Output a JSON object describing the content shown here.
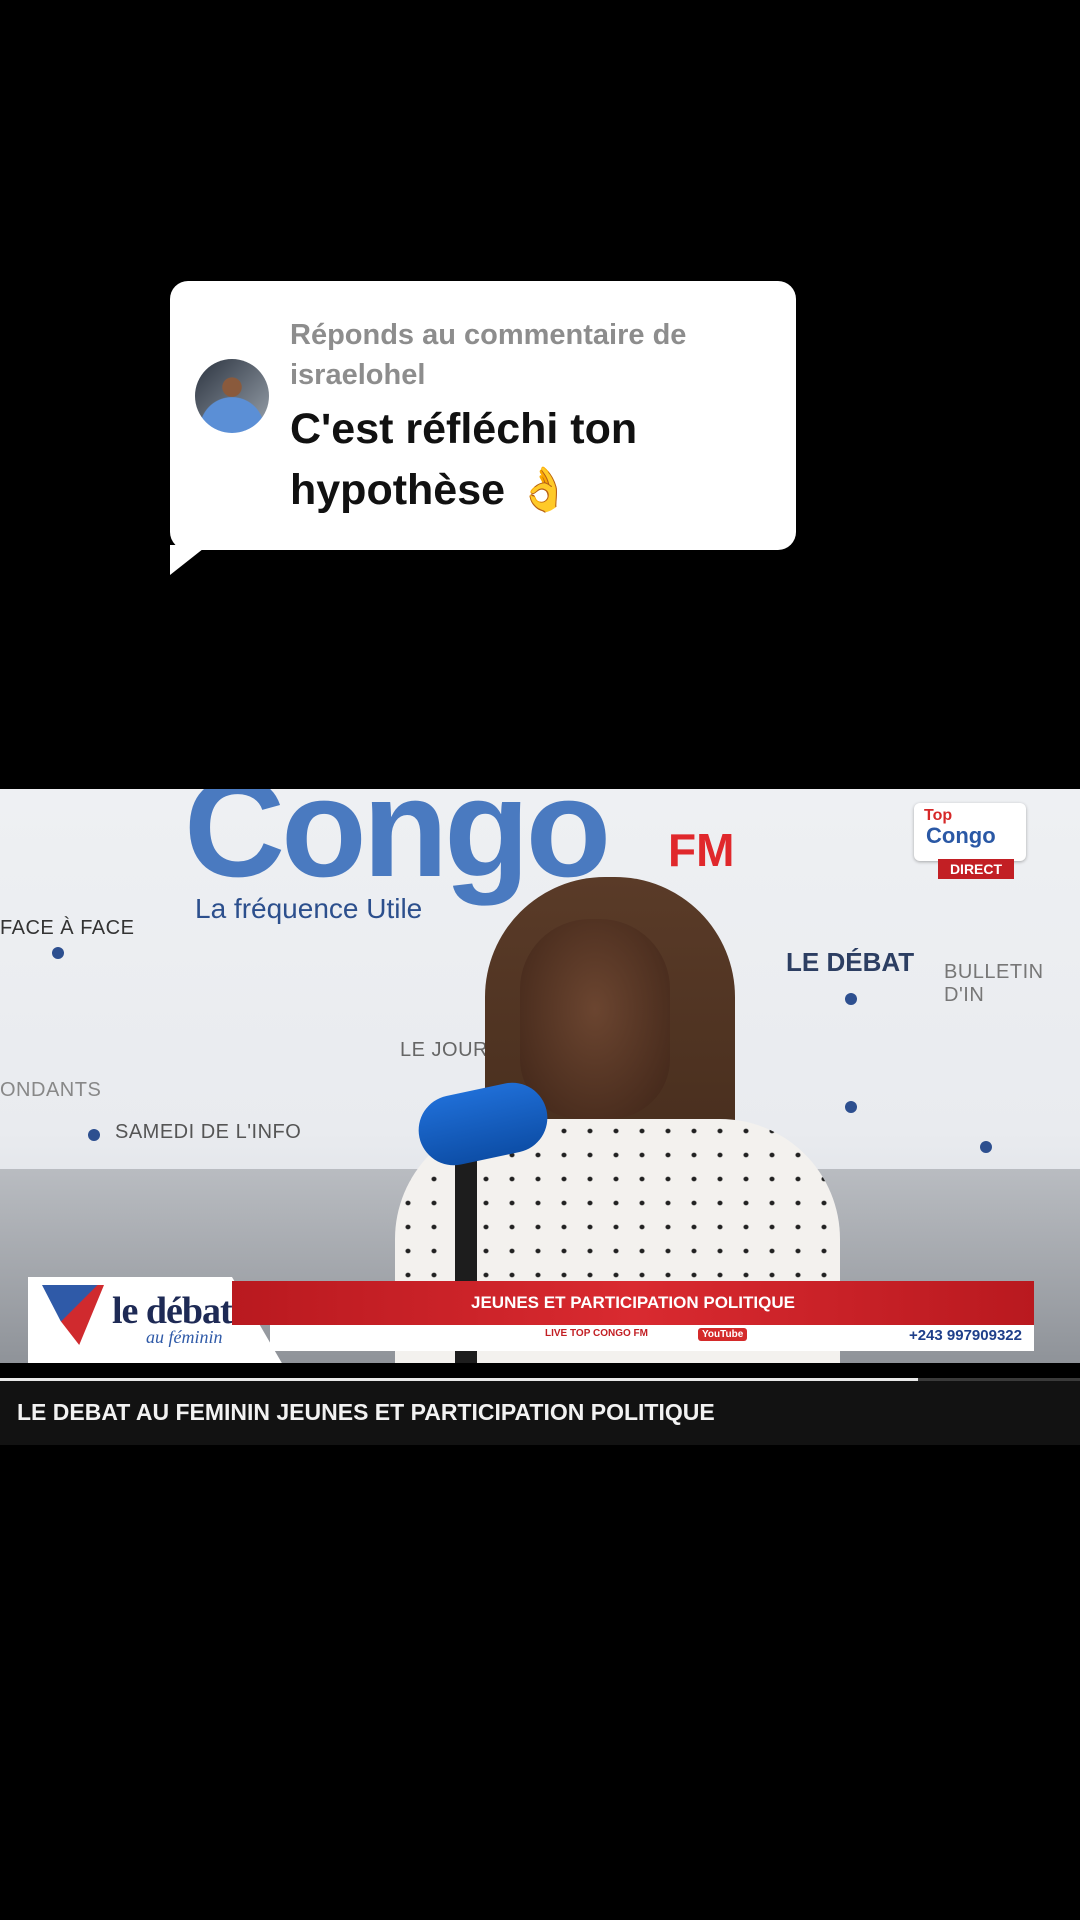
{
  "reply_bubble": {
    "label": "Réponds au commentaire de israelohel",
    "comment": "C'est réfléchi ton hypothèse",
    "emoji": "👌"
  },
  "video": {
    "background_text": {
      "brand": "Congo",
      "fm": "FM",
      "tagline": "La fréquence Utile",
      "face_a_face": "FACE À FACE",
      "le_debat": "LE DÉBAT",
      "bulletin": "BULLETIN D'IN",
      "le_journal": "LE JOURN",
      "correspondants": "ONDANTS",
      "samedi": "SAMEDI DE L'INFO"
    },
    "corner_logo": {
      "top": "Top",
      "congo": "Congo",
      "badge": "DIRECT"
    },
    "lower_third": {
      "show_logo": "le débat",
      "show_logo_sub": "au féminin",
      "headline": "JEUNES ET PARTICIPATION POLITIQUE",
      "live": "LIVE TOP CONGO FM",
      "youtube": "YouTube",
      "phone": "+243 997909322"
    }
  },
  "playback": {
    "progress": 0.85
  },
  "caption": {
    "title": "LE DEBAT AU FEMININ JEUNES ET PARTICIPATION POLITIQUE"
  },
  "colors": {
    "accent_red": "#c21f24",
    "brand_blue": "#4a7ac0"
  }
}
